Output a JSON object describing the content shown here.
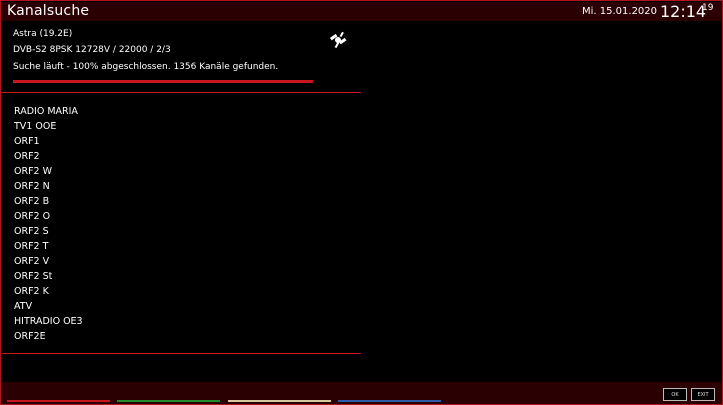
{
  "header": {
    "title": "Kanalsuche",
    "date": "Mi. 15.01.2020",
    "time": "12:14",
    "seconds": "19"
  },
  "scan": {
    "satellite": "Astra (19.2E)",
    "transponder": "DVB-S2 8PSK 12728V / 22000 / 2/3",
    "status": "Suche läuft - 100% abgeschlossen. 1356 Kanäle gefunden.",
    "progress_percent": 100,
    "icon": "satellite-icon"
  },
  "channels": [
    "RADIO MARIA",
    "TV1 OOE",
    "ORF1",
    "ORF2",
    "ORF2 W",
    "ORF2 N",
    "ORF2 B",
    "ORF2 O",
    "ORF2 S",
    "ORF2 T",
    "ORF2 V",
    "ORF2 St",
    "ORF2 K",
    "ATV",
    "HITRADIO OE3",
    "ORF2E"
  ],
  "footer": {
    "ok_label": "OK",
    "exit_label": "EXIT",
    "color_keys": [
      "red",
      "green",
      "yellow",
      "blue"
    ]
  },
  "colors": {
    "accent": "#c8161e",
    "header_bg": "#2b0003",
    "key_red": "#c8161e",
    "key_green": "#1e8c2a",
    "key_yellow": "#d8c8a0",
    "key_blue": "#2a5aa8"
  }
}
